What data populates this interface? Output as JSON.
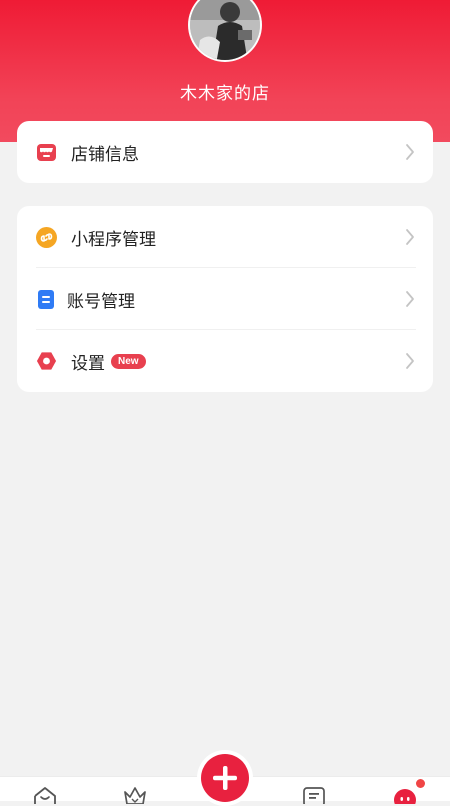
{
  "shop": {
    "name": "木木家的店"
  },
  "menu_card1": {
    "items": [
      {
        "label": "店铺信息",
        "icon": "store-icon"
      }
    ]
  },
  "menu_card2": {
    "items": [
      {
        "label": "小程序管理",
        "icon": "mini-program-icon"
      },
      {
        "label": "账号管理",
        "icon": "account-icon"
      },
      {
        "label": "设置",
        "icon": "settings-icon",
        "badge": "New"
      }
    ]
  },
  "tabbar": {
    "tabs": [
      {
        "icon": "home-icon"
      },
      {
        "icon": "crown-icon"
      },
      {
        "icon": "add-icon"
      },
      {
        "icon": "orders-icon"
      },
      {
        "icon": "profile-icon",
        "has_notification": true
      }
    ]
  },
  "colors": {
    "brand_red": "#ef1b35",
    "store_icon": "#e8404f",
    "mini_program_icon": "#f5a623",
    "account_icon": "#2f7bf5",
    "settings_icon": "#e8404f"
  }
}
